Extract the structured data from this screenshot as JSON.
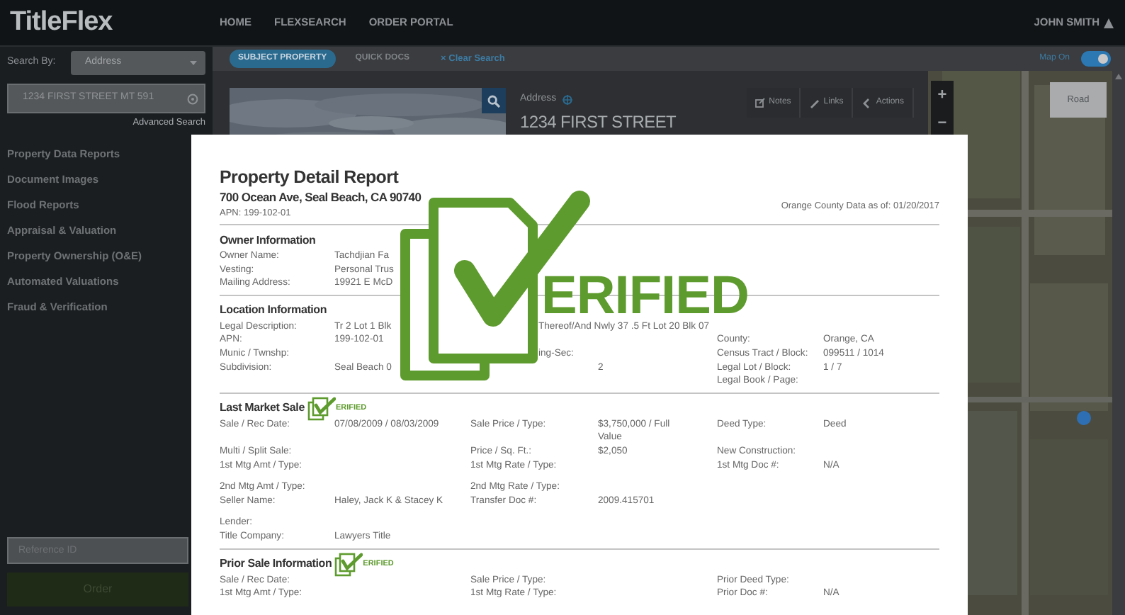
{
  "app": {
    "logo": "TitleFlex",
    "nav": [
      "HOME",
      "FLEXSEARCH",
      "ORDER PORTAL"
    ],
    "user": "JOHN SMITH"
  },
  "sidebar": {
    "search_by_label": "Search By:",
    "search_by": "Address",
    "search_value": "1234 FIRST STREET MT 591",
    "advanced_search": "Advanced Search",
    "items": [
      "Property Data Reports",
      "Document Images",
      "Flood Reports",
      "Appraisal & Valuation",
      "Property Ownership (O&E)",
      "Automated Valuations",
      "Fraud & Verification"
    ],
    "reference_placeholder": "Reference ID",
    "order_button": "Order"
  },
  "toolbar": {
    "tabs": [
      {
        "label": "SUBJECT PROPERTY",
        "selected": true
      },
      {
        "label": "QUICK DOCS",
        "selected": false
      }
    ],
    "clear_search": "× Clear Search",
    "map_toggle": {
      "label": "Map On",
      "on": true
    }
  },
  "property": {
    "address_label": "Address",
    "address": "1234 FIRST STREET",
    "buttons": [
      "Notes",
      "Links",
      "Actions"
    ]
  },
  "map": {
    "zoom_in": "+",
    "zoom_out": "−",
    "layer_button": "Road"
  },
  "report": {
    "title": "Property Detail Report",
    "address": "700 Ocean Ave, Seal Beach, CA 90740",
    "apn": "APN: 199-102-01",
    "data_date": "Orange County Data as of: 01/20/2017",
    "stamp_text": "ERIFIED",
    "sections": [
      {
        "title": "Owner Information",
        "groups": [
          [
            {
              "cells": [
                "Owner Name:",
                "Tachdjian Fa"
              ]
            },
            {
              "cells": [
                "Vesting:",
                "Personal Trus"
              ]
            },
            {
              "cells": [
                "Mailing Address:",
                "19921 E McD"
              ]
            }
          ]
        ]
      },
      {
        "title": "Location Information",
        "groups": [
          [
            {
              "kind": "covered",
              "cells": [
                "Legal Description:",
                "Tr 2 Lot 1 Blk",
                "Thereof/And Nwly 37 .5 Ft Lot 20 Blk 07"
              ]
            },
            {
              "cells": [
                "APN:",
                "199-102-01",
                null,
                null,
                "County:",
                "Orange, CA"
              ]
            },
            {
              "kind": "covered",
              "cells": [
                "Munic / Twnshp:",
                null,
                "ing-Sec:",
                null,
                "Census Tract / Block:",
                "099511 / 1014"
              ]
            },
            {
              "cells": [
                "Subdivision:",
                "Seal Beach 0",
                null,
                "2",
                "Legal Lot / Block:",
                "1 / 7"
              ]
            },
            {
              "cells": [
                null,
                null,
                null,
                null,
                "Legal Book / Page:"
              ]
            }
          ]
        ]
      },
      {
        "title": "Last Market Sale",
        "badge": "ERIFIED",
        "groups": [
          [
            {
              "cells": [
                "Sale / Rec Date:",
                "07/08/2009 / 08/03/2009",
                "Sale Price / Type:",
                "$3,750,000 / Full Value",
                "Deed Type:",
                "Deed"
              ]
            },
            {
              "cells": [
                "Multi / Split Sale:",
                null,
                "Price / Sq. Ft.:",
                "$2,050",
                "New Construction:"
              ]
            },
            {
              "cells": [
                "1st Mtg Amt / Type:",
                null,
                "1st Mtg Rate / Type:",
                null,
                "1st Mtg Doc #:",
                "N/A"
              ]
            }
          ],
          [
            {
              "cells": [
                "2nd Mtg Amt / Type:",
                null,
                "2nd Mtg Rate / Type:"
              ]
            },
            {
              "cells": [
                "Seller Name:",
                "Haley, Jack K & Stacey K",
                "Transfer Doc #:",
                "2009.415701"
              ]
            }
          ],
          [
            {
              "cells": [
                "Lender:"
              ]
            },
            {
              "cells": [
                "Title Company:",
                "Lawyers Title"
              ]
            }
          ]
        ]
      },
      {
        "title": "Prior Sale Information",
        "badge": "ERIFIED",
        "groups": [
          [
            {
              "cells": [
                "Sale / Rec Date:",
                null,
                "Sale Price / Type:",
                null,
                "Prior Deed Type:"
              ]
            },
            {
              "cells": [
                "1st Mtg Amt / Type:",
                null,
                "1st Mtg Rate / Type:",
                null,
                "Prior Doc #:",
                "N/A"
              ]
            }
          ]
        ]
      }
    ]
  }
}
